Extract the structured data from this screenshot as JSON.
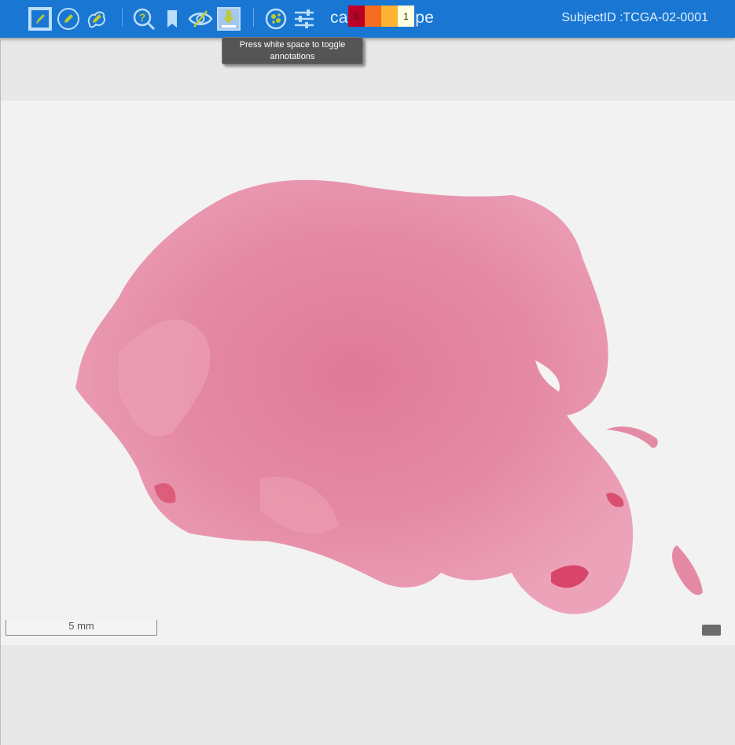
{
  "toolbar": {
    "app_title": "caMicroscope",
    "subject_id": "SubjectID :TCGA-02-0001",
    "tooltip": "Press white space to toggle annotations",
    "tools": [
      {
        "name": "draw-icon",
        "active": true
      },
      {
        "name": "sketch-icon",
        "active": false
      },
      {
        "name": "freeline-icon",
        "active": false
      },
      {
        "name": "magnifier-help-icon",
        "active": false
      },
      {
        "name": "bookmark-icon",
        "active": false
      },
      {
        "name": "toggle-annotations-icon",
        "active": false
      },
      {
        "name": "download-icon",
        "active": true
      },
      {
        "name": "analysis-icon",
        "active": false
      },
      {
        "name": "settings-sliders-icon",
        "active": false
      }
    ],
    "heatmap_legend": {
      "colors": [
        "#bd0026",
        "#f46d21",
        "#fdb334",
        "#ffffe0"
      ],
      "labels": [
        "0",
        "",
        "",
        "1"
      ]
    }
  },
  "viewer": {
    "scale_label": "5 mm",
    "tissue_color": "#e58aa4",
    "background_color": "#f2f2f3"
  }
}
